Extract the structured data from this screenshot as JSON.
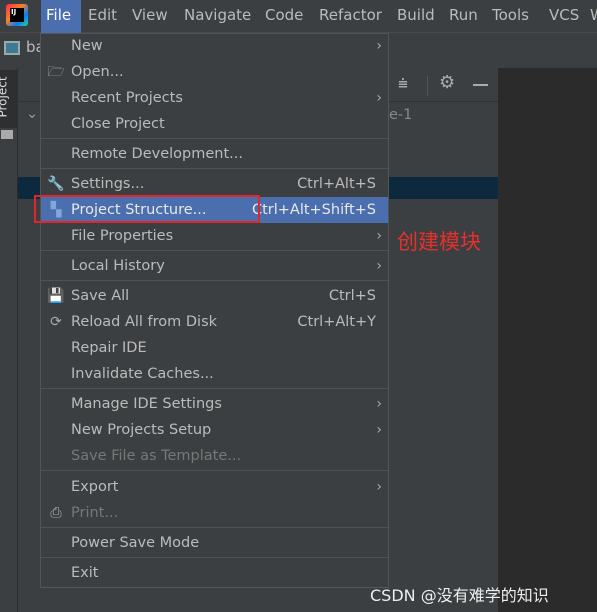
{
  "menubar": {
    "items": [
      "File",
      "Edit",
      "View",
      "Navigate",
      "Code",
      "Refactor",
      "Build",
      "Run",
      "Tools",
      "VCS",
      "W"
    ],
    "active": "File"
  },
  "sidebar": {
    "project_tab": "Project"
  },
  "background": {
    "tab_text": "ba",
    "tree_text": "e-1"
  },
  "file_menu": {
    "items": [
      {
        "label": "New",
        "submenu": true
      },
      {
        "label": "Open...",
        "icon": "folder-open-icon"
      },
      {
        "label": "Recent Projects",
        "submenu": true
      },
      {
        "label": "Close Project"
      },
      {
        "label": "Remote Development..."
      },
      {
        "label": "Settings...",
        "shortcut": "Ctrl+Alt+S",
        "icon": "wrench-icon"
      },
      {
        "label": "Project Structure...",
        "shortcut": "Ctrl+Alt+Shift+S",
        "icon": "project-structure-icon",
        "highlighted": true
      },
      {
        "label": "File Properties",
        "submenu": true
      },
      {
        "label": "Local History",
        "submenu": true
      },
      {
        "label": "Save All",
        "shortcut": "Ctrl+S",
        "icon": "save-icon"
      },
      {
        "label": "Reload All from Disk",
        "shortcut": "Ctrl+Alt+Y",
        "icon": "reload-icon"
      },
      {
        "label": "Repair IDE"
      },
      {
        "label": "Invalidate Caches..."
      },
      {
        "label": "Manage IDE Settings",
        "submenu": true
      },
      {
        "label": "New Projects Setup",
        "submenu": true
      },
      {
        "label": "Save File as Template...",
        "disabled": true
      },
      {
        "label": "Export",
        "submenu": true
      },
      {
        "label": "Print...",
        "disabled": true,
        "icon": "print-icon"
      },
      {
        "label": "Power Save Mode"
      },
      {
        "label": "Exit"
      }
    ]
  },
  "annotation": {
    "text": "创建模块",
    "color": "#e8302a"
  },
  "watermark": "CSDN @没有难学的知识",
  "colors": {
    "highlight": "#4b6eaf",
    "background": "#3c3f41",
    "editor": "#2b2b2b"
  }
}
